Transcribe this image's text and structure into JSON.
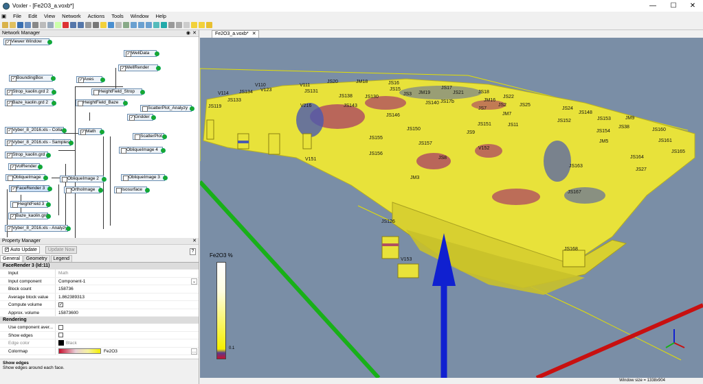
{
  "window": {
    "title": "Voxler - [Fe2O3_a.voxb*]",
    "minimize_glyph": "—",
    "maximize_glyph": "☐",
    "close_glyph": "✕"
  },
  "menu": [
    "File",
    "Edit",
    "View",
    "Network",
    "Actions",
    "Tools",
    "Window",
    "Help"
  ],
  "network_manager": {
    "title": "Network Manager",
    "nodes": [
      {
        "label": "Viewer Window"
      },
      {
        "label": "WellData"
      },
      {
        "label": "WellRender"
      },
      {
        "label": "BoundingBox"
      },
      {
        "label": "Axes"
      },
      {
        "label": "Strop_kaolin.grd 2"
      },
      {
        "label": "HeightField_Strop"
      },
      {
        "label": "Baze_kaolin.grd 2"
      },
      {
        "label": "HeightField_Baze"
      },
      {
        "label": "ScatterPlot_Analyzy"
      },
      {
        "label": "Gridder"
      },
      {
        "label": "Vyber_8_2016.xls - Collars"
      },
      {
        "label": "Math"
      },
      {
        "label": "ScatterPlot"
      },
      {
        "label": "Vyber_8_2016.xls - Samples"
      },
      {
        "label": "ObliqueImage 4"
      },
      {
        "label": "Strop_kaolin.grd"
      },
      {
        "label": "VolRender"
      },
      {
        "label": "ObliqueImage"
      },
      {
        "label": "ObliqueImage 2"
      },
      {
        "label": "ObliqueImage 3"
      },
      {
        "label": "FaceRender 3"
      },
      {
        "label": "OrthoImage"
      },
      {
        "label": "Isosurface"
      },
      {
        "label": "HeightField 3"
      },
      {
        "label": "Baze_kaolin.grd"
      },
      {
        "label": "Vyber_8_2016.xls - Analyzy"
      }
    ]
  },
  "property_manager": {
    "title": "Property Manager",
    "auto_update": "Auto Update",
    "update_now": "Update Now",
    "help": "?",
    "tabs": [
      "General",
      "Geometry",
      "Legend"
    ],
    "section_main": "FaceRender 3 (Id:11)",
    "rows": [
      {
        "label": "Input",
        "value": "Math",
        "dim_value": true
      },
      {
        "label": "Input component",
        "value": "Component-1",
        "dropdown": true
      },
      {
        "label": "Block count",
        "value": "158736"
      },
      {
        "label": "Average block value",
        "value": "1.862389313"
      },
      {
        "label": "Compute volume",
        "value": "",
        "checkbox": true,
        "checked": true
      },
      {
        "label": "Approx. volume",
        "value": "15873600"
      }
    ],
    "section_render": "Rendering",
    "render_rows": [
      {
        "label": "Use component aver...",
        "checkbox": true,
        "checked": false
      },
      {
        "label": "Show edges",
        "checkbox": true,
        "checked": false
      },
      {
        "label": "Edge color",
        "value": "Black",
        "dim": true
      },
      {
        "label": "Colormap",
        "value": "Fe2O3"
      }
    ],
    "desc_title": "Show edges",
    "desc_text": "Show edges around each face."
  },
  "viewer": {
    "tab_label": "Fe2O3_a.voxb*",
    "legend_title": "Fe2O3 %",
    "legend_tick": "0.1",
    "status": "Window size = 1338x904",
    "wells": [
      "V114",
      "JS134",
      "V110",
      "V123",
      "V111",
      "JS131",
      "JS20",
      "JM18",
      "JS16",
      "JS15",
      "JS3",
      "JM19",
      "JS17",
      "JS21",
      "JS18",
      "JS22",
      "JM16",
      "JS25",
      "JS140",
      "JS138",
      "JS130",
      "JS146",
      "JS150",
      "JS9",
      "JS151",
      "JS11",
      "JS152",
      "JS24",
      "JS148",
      "JS153",
      "JM9",
      "JS154",
      "JS38",
      "JS160",
      "JS161",
      "JS165",
      "JM5",
      "JS155",
      "JS157",
      "V152",
      "JS156",
      "JS163",
      "JS164",
      "JS27",
      "JS167",
      "JS8",
      "JM3",
      "V151",
      "JS126",
      "V153",
      "JS168",
      "JS119",
      "JS7",
      "JS2",
      "JS143",
      "JS133",
      "V216",
      "JS17b",
      "JM7"
    ]
  }
}
